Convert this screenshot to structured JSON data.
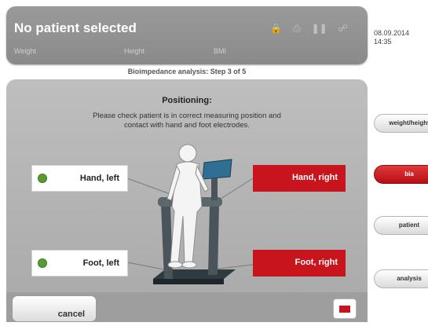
{
  "header": {
    "title": "No patient selected",
    "metrics": {
      "weight": "Weight",
      "height": "Height",
      "bmi": "BMI"
    },
    "icons": [
      "lock-icon",
      "printer-icon",
      "pause-icon",
      "network-icon"
    ]
  },
  "datetime": {
    "date": "08.09.2014",
    "time": "14:35"
  },
  "step": "Bioimpedance analysis: Step 3 of 5",
  "positioning": {
    "title": "Positioning:",
    "instruction_line1": "Please check patient is in correct measuring position and",
    "instruction_line2": "contact with hand and foot electrodes."
  },
  "electrodes": {
    "hand_left": {
      "label": "Hand, left",
      "status": "ok"
    },
    "foot_left": {
      "label": "Foot, left",
      "status": "ok"
    },
    "hand_right": {
      "label": "Hand, right",
      "status": "no-contact"
    },
    "foot_right": {
      "label": "Foot, right",
      "status": "no-contact"
    }
  },
  "colors": {
    "no_contact": "#c8141c",
    "ok": "#5a9a32",
    "panel": "#b3b3b3"
  },
  "footer": {
    "cancel_label": "cancel"
  },
  "sidebar": {
    "items": [
      {
        "label": "weight/height",
        "active": false
      },
      {
        "label": "bia",
        "active": true
      },
      {
        "label": "patient",
        "active": false
      },
      {
        "label": "analysis",
        "active": false
      }
    ]
  }
}
